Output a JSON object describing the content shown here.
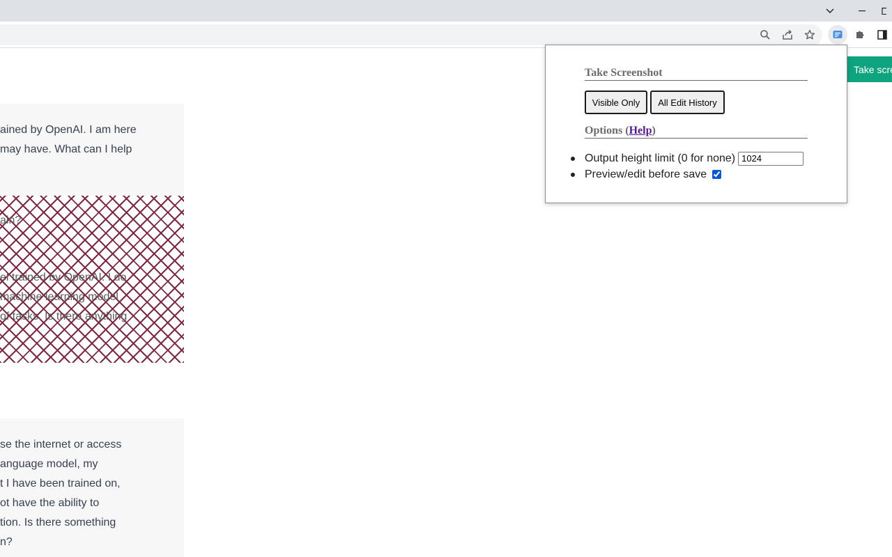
{
  "page": {
    "block1_lines": [
      "ained by OpenAI. I am here",
      "may have. What can I help"
    ],
    "hatched_lines": [
      "ain?",
      "",
      "",
      "el trained by OpenAI. I do",
      "machine learning model",
      "of tasks. Is there anything"
    ],
    "block2_lines": [
      "se the internet or access",
      "anguage model, my",
      "t I have been trained on,",
      "ot have the ability to",
      "tion. Is there something",
      "n?"
    ],
    "take_screenshot_button": "Take scre"
  },
  "popup": {
    "section1_title": "Take Screenshot",
    "visible_only_label": "Visible Only",
    "all_edit_history_label": "All Edit History",
    "options_label": "Options (",
    "help_label": "Help",
    "options_close": ")",
    "height_limit_label": "Output height limit (0 for none)",
    "height_limit_value": "1024",
    "preview_label": "Preview/edit before save",
    "preview_checked": true
  },
  "icons": {
    "tab_list": "chevron-down-icon",
    "minimize": "minimize-icon",
    "zoom": "magnifier-icon",
    "share": "share-icon",
    "bookmark": "star-icon",
    "extension_active": "screenshot-extension-icon",
    "extensions": "puzzle-icon",
    "side_panel": "side-panel-icon"
  },
  "colors": {
    "accent_green": "#10a37f",
    "hatch": "#7b2a43",
    "link": "#551a8b"
  }
}
